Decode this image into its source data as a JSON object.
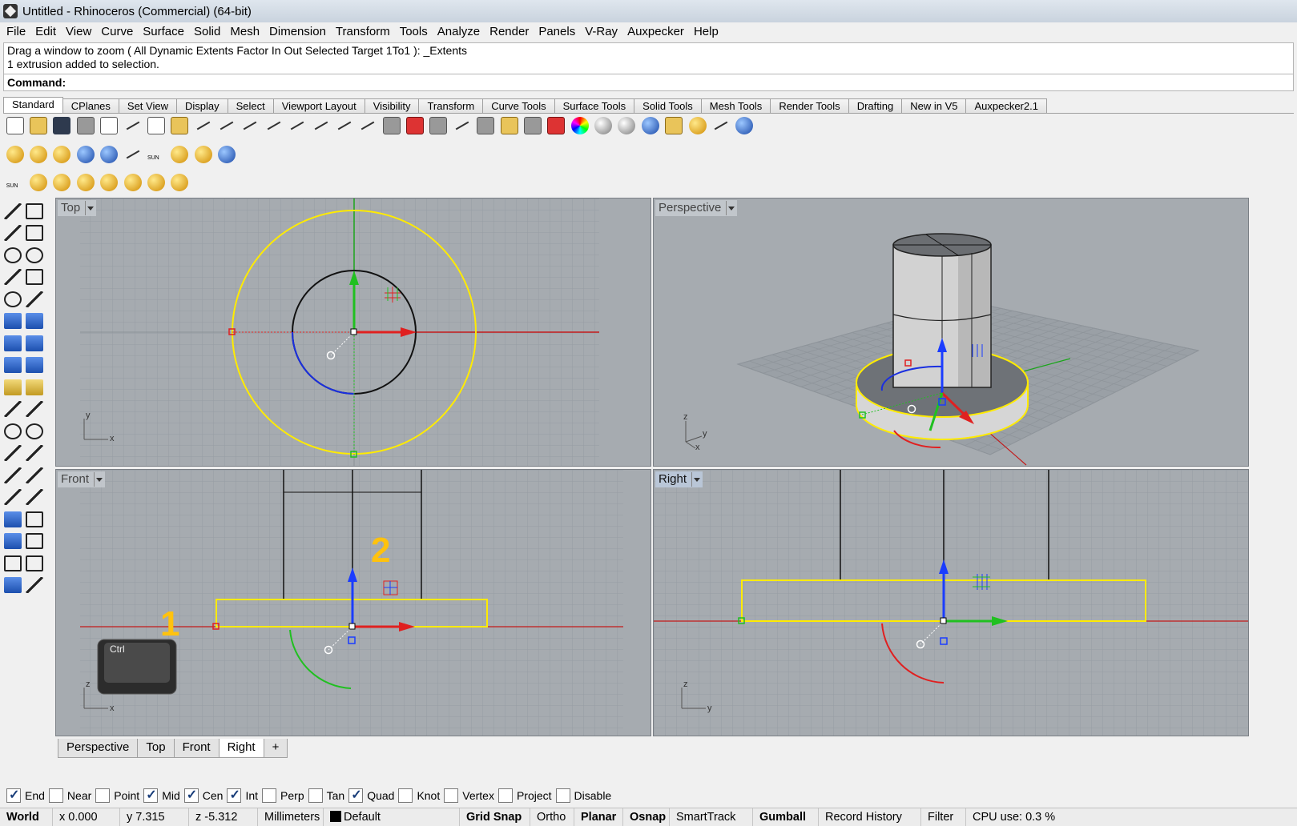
{
  "window": {
    "title": "Untitled - Rhinoceros (Commercial) (64-bit)"
  },
  "menu": [
    "File",
    "Edit",
    "View",
    "Curve",
    "Surface",
    "Solid",
    "Mesh",
    "Dimension",
    "Transform",
    "Tools",
    "Analyze",
    "Render",
    "Panels",
    "V-Ray",
    "Auxpecker",
    "Help"
  ],
  "command": {
    "history_line1": "Drag a window to zoom ( All  Dynamic  Extents  Factor  In  Out  Selected  Target  1To1 ): _Extents",
    "history_line2": "1 extrusion added to selection.",
    "prompt": "Command:"
  },
  "toolbar_tabs": [
    "Standard",
    "CPlanes",
    "Set View",
    "Display",
    "Select",
    "Viewport Layout",
    "Visibility",
    "Transform",
    "Curve Tools",
    "Surface Tools",
    "Solid Tools",
    "Mesh Tools",
    "Render Tools",
    "Drafting",
    "New in V5",
    "Auxpecker2.1"
  ],
  "toolbar_icons": [
    "new-icon",
    "open-icon",
    "save-icon",
    "print-icon",
    "import-icon",
    "cut-icon",
    "copy-icon",
    "paste-icon",
    "undo-icon",
    "pan-icon",
    "rotate-view-icon",
    "zoom-icon",
    "zoom-window-icon",
    "zoom-extents-icon",
    "zoom-selected-icon",
    "undo-view-icon",
    "viewport-layout-icon",
    "car-icon",
    "set-view-icon",
    "select-icon",
    "grid-icon",
    "light-icon",
    "lock-icon",
    "layer-icon",
    "color-wheel-icon",
    "sphere-shade-icon",
    "render-icon",
    "render-blue-icon",
    "properties-icon",
    "options-icon",
    "move-icon",
    "help-icon"
  ],
  "toolbar2_icons": [
    "vray-material-icon",
    "vray-lights-icon",
    "vray-tag-icon",
    "vray-render-icon",
    "vray-rt-icon",
    "vray-frame-buffer-icon",
    "vray-sun-icon",
    "vray-dome-icon",
    "vray-fur-icon",
    "vray-help-icon"
  ],
  "toolbar3_labels": {
    "sun": "SUN",
    "sun2": "SUN"
  },
  "toolbar2_sun": "SUN",
  "viewports": {
    "top": {
      "label": "Top",
      "axis1": "y",
      "axis2": "x"
    },
    "perspective": {
      "label": "Perspective",
      "axis1": "z",
      "axis2": "y",
      "axis3": "x"
    },
    "front": {
      "label": "Front",
      "axis1": "z",
      "axis2": "x",
      "annot1": "1",
      "annot2": "2",
      "key_label": "Ctrl"
    },
    "right": {
      "label": "Right",
      "axis1": "z",
      "axis2": "y"
    }
  },
  "viewport_tabs": [
    "Perspective",
    "Top",
    "Front",
    "Right",
    "+"
  ],
  "osnaps": [
    {
      "label": "End",
      "on": true
    },
    {
      "label": "Near",
      "on": false
    },
    {
      "label": "Point",
      "on": false
    },
    {
      "label": "Mid",
      "on": true
    },
    {
      "label": "Cen",
      "on": true
    },
    {
      "label": "Int",
      "on": true
    },
    {
      "label": "Perp",
      "on": false
    },
    {
      "label": "Tan",
      "on": false
    },
    {
      "label": "Quad",
      "on": true
    },
    {
      "label": "Knot",
      "on": false
    },
    {
      "label": "Vertex",
      "on": false
    },
    {
      "label": "Project",
      "on": false
    },
    {
      "label": "Disable",
      "on": false
    }
  ],
  "status": {
    "cplane": "World",
    "x": "x 0.000",
    "y": "y 7.315",
    "z": "z -5.312",
    "units": "Millimeters",
    "layer": "Default",
    "grid_snap": "Grid Snap",
    "ortho": "Ortho",
    "planar": "Planar",
    "osnap": "Osnap",
    "smarttrack": "SmartTrack",
    "gumball": "Gumball",
    "record_history": "Record History",
    "filter": "Filter",
    "cpu": "CPU use: 0.3 %"
  },
  "colors": {
    "viewport_bg": "#a6abb0",
    "grid": "#9aa0a6",
    "selection": "#ffeb00",
    "x_axis": "#e02020",
    "y_axis": "#20c020",
    "z_axis": "#1a3cff",
    "annotation": "#ffc20e"
  }
}
